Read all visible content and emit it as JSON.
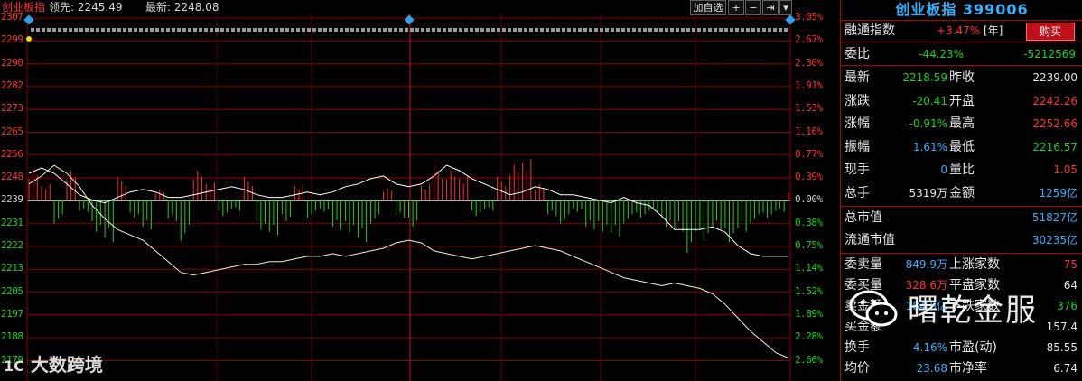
{
  "header": {
    "index_name": "创业板指",
    "lead_label": "领先:",
    "lead_value": "2245.49",
    "latest_label": "最新:",
    "latest_value": "2248.08",
    "add_watch": "加自选",
    "btn_plus": "+",
    "btn_minus": "−",
    "btn_jump": "⇥",
    "btn_menu": "▾"
  },
  "price_axis": [
    "2307",
    "2299",
    "2290",
    "2282",
    "2273",
    "2265",
    "2256",
    "2248",
    "2239",
    "2231",
    "2222",
    "2213",
    "2205",
    "2197",
    "2188",
    "2179"
  ],
  "pct_axis": [
    "3.05%",
    "2.67%",
    "2.30%",
    "1.91%",
    "1.53%",
    "1.16%",
    "0.77%",
    "0.39%",
    "0.00%",
    "0.38%",
    "0.75%",
    "1.14%",
    "1.52%",
    "1.89%",
    "2.28%",
    "2.66%"
  ],
  "colors": {
    "up": "#ff3030",
    "down": "#19d41b",
    "neutral": "#cccccc",
    "accent": "#2fb3ff",
    "grid": "#8b0000"
  },
  "panel": {
    "title": "创业板指 399006",
    "buy_label": "购买",
    "rongtong_label": "融通指数",
    "rongtong_value": "+3.47%",
    "rongtong_unit": "[年]",
    "weibi_label": "委比",
    "weibi_pct": "-44.23%",
    "weibi_diff": "-5212569",
    "rows1": [
      {
        "l1": "最新",
        "v1": "2218.59",
        "c1": "dn",
        "l2": "昨收",
        "v2": "2239.00",
        "c2": "wt"
      },
      {
        "l1": "涨跌",
        "v1": "-20.41",
        "c1": "dn",
        "l2": "开盘",
        "v2": "2242.26",
        "c2": "up"
      },
      {
        "l1": "涨幅",
        "v1": "-0.91%",
        "c1": "dn",
        "l2": "最高",
        "v2": "2252.66",
        "c2": "up"
      },
      {
        "l1": "振幅",
        "v1": "1.61%",
        "c1": "bl",
        "l2": "最低",
        "v2": "2216.57",
        "c2": "dn"
      },
      {
        "l1": "现手",
        "v1": "0",
        "c1": "bl",
        "l2": "量比",
        "v2": "1.05",
        "c2": "up"
      },
      {
        "l1": "总手",
        "v1": "5319万",
        "c1": "wt",
        "l2": "金额",
        "v2": "1259亿",
        "c2": "bl"
      }
    ],
    "total_mv_label": "总市值",
    "total_mv": "51827亿",
    "float_mv_label": "流通市值",
    "float_mv": "30235亿",
    "rows2": [
      {
        "l1": "委卖量",
        "v1": "849.9万",
        "c1": "bl",
        "l2": "上涨家数",
        "v2": "75",
        "c2": "up"
      },
      {
        "l1": "委买量",
        "v1": "328.6万",
        "c1": "up",
        "l2": "平盘家数",
        "v2": "64",
        "c2": "wt"
      },
      {
        "l1": "卖金额",
        "v1": "184.5亿",
        "c1": "bl",
        "l2": "下跌家数",
        "v2": "376",
        "c2": "dn"
      },
      {
        "l1": "买金额",
        "v1": "",
        "c1": "bl",
        "l2": "",
        "v2": "157.4",
        "c2": "wt"
      },
      {
        "l1": "换手",
        "v1": "4.16%",
        "c1": "bl",
        "l2": "市盈(动)",
        "v2": "85.55",
        "c2": "wt"
      },
      {
        "l1": "均价",
        "v1": "23.68",
        "c1": "bl",
        "l2": "市净率",
        "v2": "6.74",
        "c2": "wt"
      }
    ]
  },
  "watermarks": {
    "wechat": "曙乾金服",
    "corner": "大数跨境"
  },
  "chart_data": {
    "type": "line",
    "base": 2239,
    "ylim": [
      2179,
      2307
    ],
    "lead_line": [
      2245,
      2248,
      2252,
      2249,
      2244,
      2237,
      2232,
      2228,
      2226,
      2224,
      2220,
      2216,
      2212,
      2211,
      2212,
      2213,
      2214,
      2215,
      2215,
      2216,
      2216,
      2217,
      2218,
      2218,
      2219,
      2218,
      2219,
      2220,
      2221,
      2223,
      2224,
      2223,
      2220,
      2219,
      2218,
      2217,
      2218,
      2219,
      2220,
      2221,
      2222,
      2221,
      2220,
      2218,
      2216,
      2214,
      2212,
      2210,
      2209,
      2208,
      2207,
      2208,
      2207,
      2206,
      2204,
      2200,
      2195,
      2190,
      2186,
      2182,
      2180
    ],
    "index_line": [
      2249,
      2251,
      2249,
      2245,
      2241,
      2239,
      2238,
      2240,
      2242,
      2243,
      2242,
      2240,
      2240,
      2241,
      2242,
      2243,
      2244,
      2243,
      2241,
      2240,
      2240,
      2241,
      2242,
      2241,
      2242,
      2244,
      2245,
      2247,
      2248,
      2245,
      2244,
      2245,
      2248,
      2252,
      2250,
      2247,
      2245,
      2243,
      2241,
      2242,
      2244,
      2243,
      2241,
      2241,
      2240,
      2239,
      2238,
      2240,
      2238,
      2237,
      2233,
      2228,
      2228,
      2228,
      2229,
      2227,
      2222,
      2219,
      2218,
      2218,
      2218
    ],
    "volume_bars": [
      6,
      3,
      -4,
      5,
      -2,
      -6,
      -8,
      4,
      -3,
      -5,
      2,
      -4,
      -7,
      5,
      3,
      -3,
      -2,
      4,
      -5,
      -6,
      -4,
      3,
      -3,
      -2,
      -5,
      -6,
      -8,
      -4,
      2,
      -3,
      -5,
      3,
      6,
      5,
      4,
      -3,
      -2,
      4,
      6,
      7,
      3,
      -3,
      -4,
      -2,
      -5,
      -6,
      -7,
      -4,
      -3,
      -2,
      -5,
      -6,
      -9,
      -7,
      -5,
      -8,
      -6,
      -4,
      -3,
      -2,
      2
    ],
    "x_points": 61
  }
}
